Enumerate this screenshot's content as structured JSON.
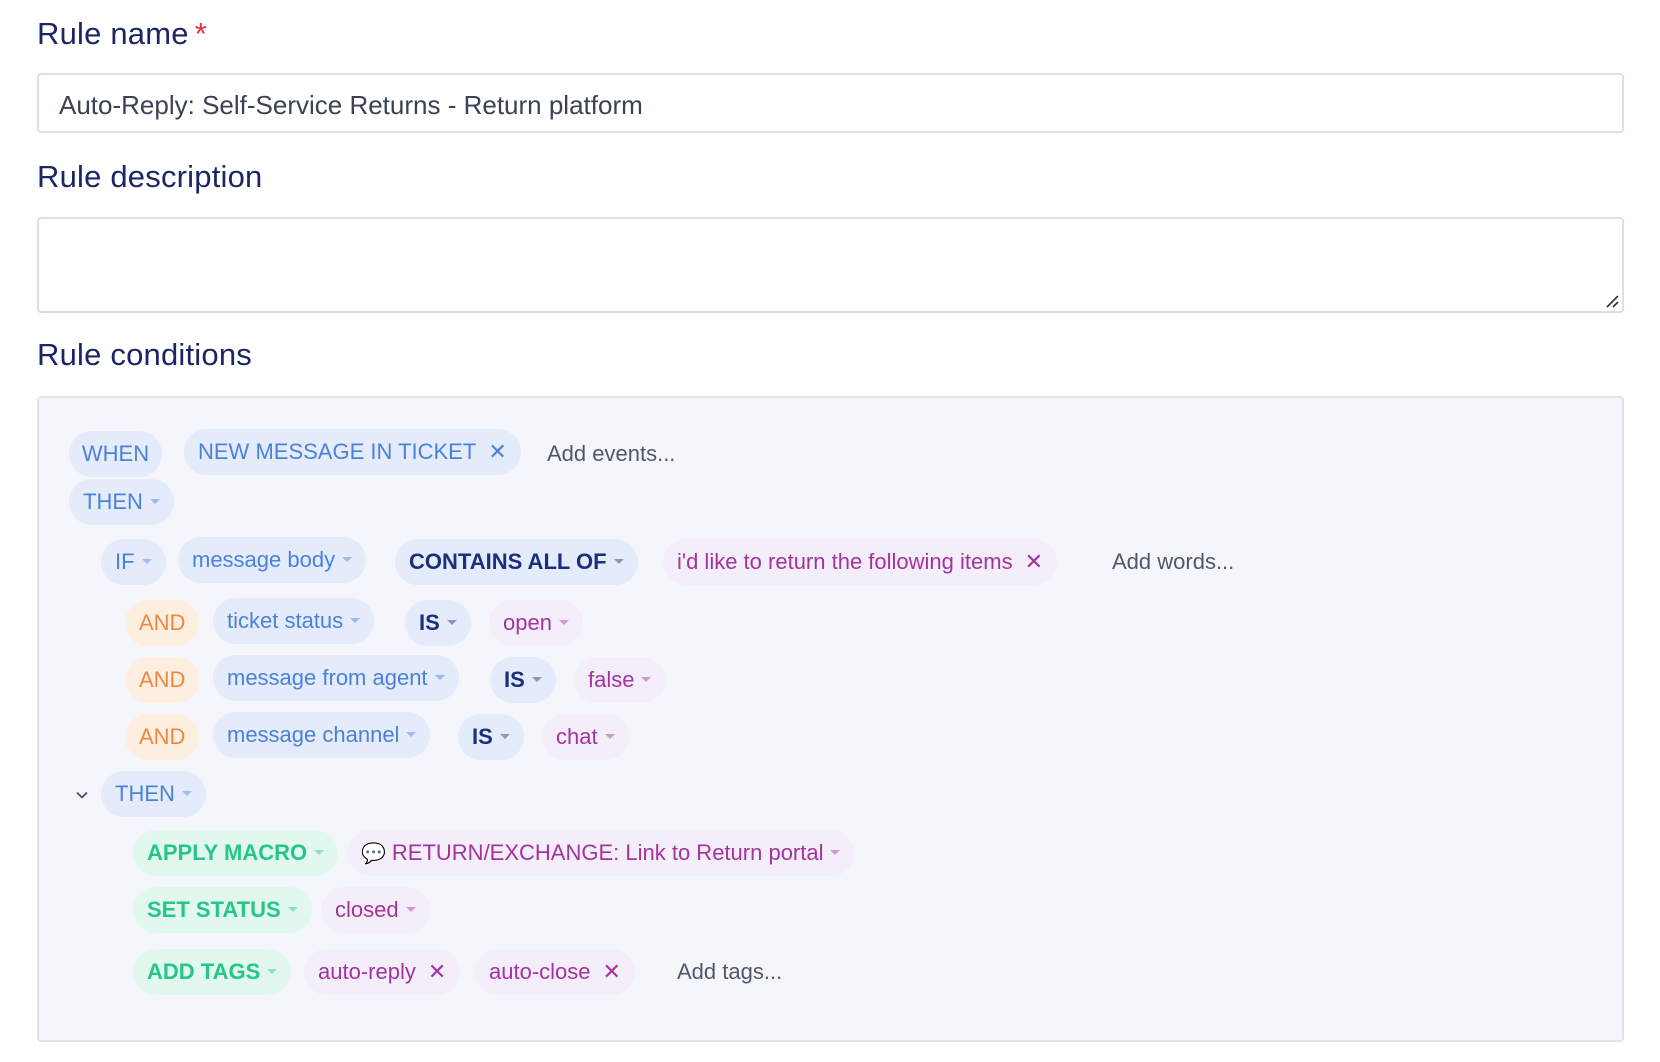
{
  "fields": {
    "rule_name_label": "Rule name",
    "required_mark": "*",
    "rule_name_value": "Auto-Reply: Self-Service Returns - Return platform",
    "rule_description_label": "Rule description",
    "rule_description_value": "",
    "rule_conditions_label": "Rule conditions"
  },
  "conditions": {
    "when": "WHEN",
    "event": "NEW MESSAGE IN TICKET",
    "add_events": "Add events...",
    "then1": "THEN",
    "if": "IF",
    "if_field": "message body",
    "if_operator": "CONTAINS ALL OF",
    "if_value": "i'd like to return the following items",
    "add_words": "Add words...",
    "and_rows": [
      {
        "label": "AND",
        "field": "ticket status",
        "op": "IS",
        "value": "open"
      },
      {
        "label": "AND",
        "field": "message from agent",
        "op": "IS",
        "value": "false"
      },
      {
        "label": "AND",
        "field": "message channel",
        "op": "IS",
        "value": "chat"
      }
    ],
    "then2": "THEN",
    "actions": {
      "apply_macro": "APPLY MACRO",
      "macro_value": "RETURN/EXCHANGE: Link to Return portal",
      "set_status": "SET STATUS",
      "status_value": "closed",
      "add_tags": "ADD TAGS",
      "tags": [
        "auto-reply",
        "auto-close"
      ],
      "add_tags_placeholder": "Add tags..."
    }
  },
  "icons": {
    "remove": "close-icon",
    "dropdown": "caret-down-icon",
    "collapse": "chevron-down-icon",
    "macro": "speech-bubble-icon",
    "resize": "resize-handle-icon"
  }
}
